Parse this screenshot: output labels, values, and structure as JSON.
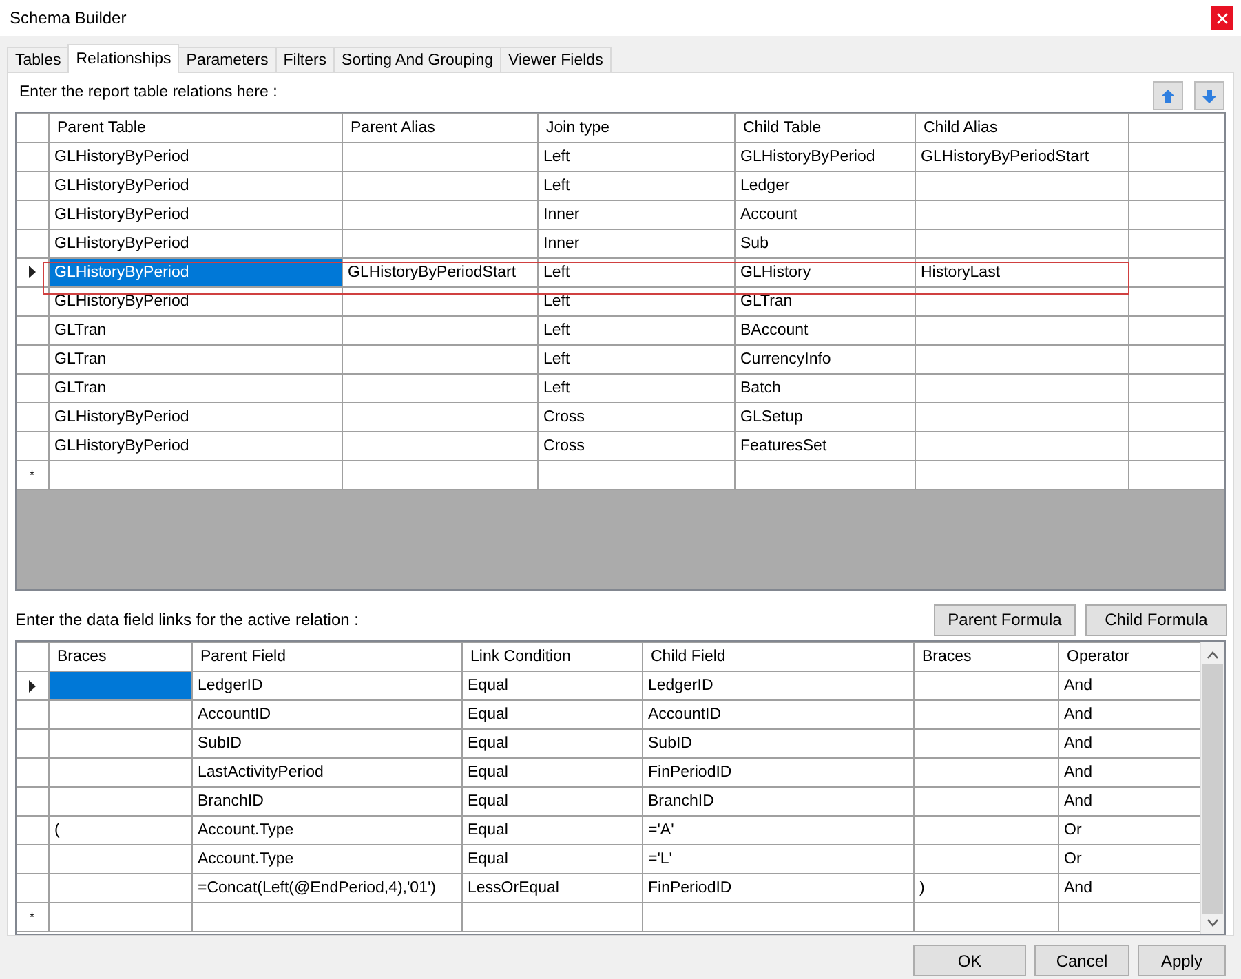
{
  "window": {
    "title": "Schema Builder"
  },
  "tabs": [
    {
      "label": "Tables",
      "selected": false
    },
    {
      "label": "Relationships",
      "selected": true
    },
    {
      "label": "Parameters",
      "selected": false
    },
    {
      "label": "Filters",
      "selected": false
    },
    {
      "label": "Sorting And Grouping",
      "selected": false
    },
    {
      "label": "Viewer Fields",
      "selected": false
    }
  ],
  "relations": {
    "prompt": "Enter the report table relations here :",
    "columns": [
      "Parent Table",
      "Parent Alias",
      "Join type",
      "Child Table",
      "Child Alias"
    ],
    "rows": [
      {
        "cells": [
          "GLHistoryByPeriod",
          "",
          "Left",
          "GLHistoryByPeriod",
          "GLHistoryByPeriodStart"
        ],
        "selected": false
      },
      {
        "cells": [
          "GLHistoryByPeriod",
          "",
          "Left",
          "Ledger",
          ""
        ],
        "selected": false
      },
      {
        "cells": [
          "GLHistoryByPeriod",
          "",
          "Inner",
          "Account",
          ""
        ],
        "selected": false
      },
      {
        "cells": [
          "GLHistoryByPeriod",
          "",
          "Inner",
          "Sub",
          ""
        ],
        "selected": false
      },
      {
        "cells": [
          "GLHistoryByPeriod",
          "GLHistoryByPeriodStart",
          "Left",
          "GLHistory",
          "HistoryLast"
        ],
        "selected": true
      },
      {
        "cells": [
          "GLHistoryByPeriod",
          "",
          "Left",
          "GLTran",
          ""
        ],
        "selected": false
      },
      {
        "cells": [
          "GLTran",
          "",
          "Left",
          "BAccount",
          ""
        ],
        "selected": false
      },
      {
        "cells": [
          "GLTran",
          "",
          "Left",
          "CurrencyInfo",
          ""
        ],
        "selected": false
      },
      {
        "cells": [
          "GLTran",
          "",
          "Left",
          "Batch",
          ""
        ],
        "selected": false
      },
      {
        "cells": [
          "GLHistoryByPeriod",
          "",
          "Cross",
          "GLSetup",
          ""
        ],
        "selected": false
      },
      {
        "cells": [
          "GLHistoryByPeriod",
          "",
          "Cross",
          "FeaturesSet",
          ""
        ],
        "selected": false
      }
    ],
    "new_row_marker": "*"
  },
  "links": {
    "prompt": "Enter the data field links for the active relation :",
    "buttons": [
      "Parent Formula",
      "Child Formula"
    ],
    "columns": [
      "Braces",
      "Parent Field",
      "Link Condition",
      "Child Field",
      "Braces",
      "Operator"
    ],
    "rows": [
      {
        "cells": [
          "",
          "LedgerID",
          "Equal",
          "LedgerID",
          "",
          "And"
        ],
        "selected": true
      },
      {
        "cells": [
          "",
          "AccountID",
          "Equal",
          "AccountID",
          "",
          "And"
        ],
        "selected": false
      },
      {
        "cells": [
          "",
          "SubID",
          "Equal",
          "SubID",
          "",
          "And"
        ],
        "selected": false
      },
      {
        "cells": [
          "",
          "LastActivityPeriod",
          "Equal",
          "FinPeriodID",
          "",
          "And"
        ],
        "selected": false
      },
      {
        "cells": [
          "",
          "BranchID",
          "Equal",
          "BranchID",
          "",
          "And"
        ],
        "selected": false
      },
      {
        "cells": [
          "(",
          "Account.Type",
          "Equal",
          "='A'",
          "",
          "Or"
        ],
        "selected": false
      },
      {
        "cells": [
          "",
          "Account.Type",
          "Equal",
          "='L'",
          "",
          "Or"
        ],
        "selected": false
      },
      {
        "cells": [
          "",
          "=Concat(Left(@EndPeriod,4),'01')",
          "LessOrEqual",
          "FinPeriodID",
          ")",
          "And"
        ],
        "selected": false
      }
    ],
    "new_row_marker": "*"
  },
  "buttons": [
    "OK",
    "Cancel",
    "Apply"
  ]
}
